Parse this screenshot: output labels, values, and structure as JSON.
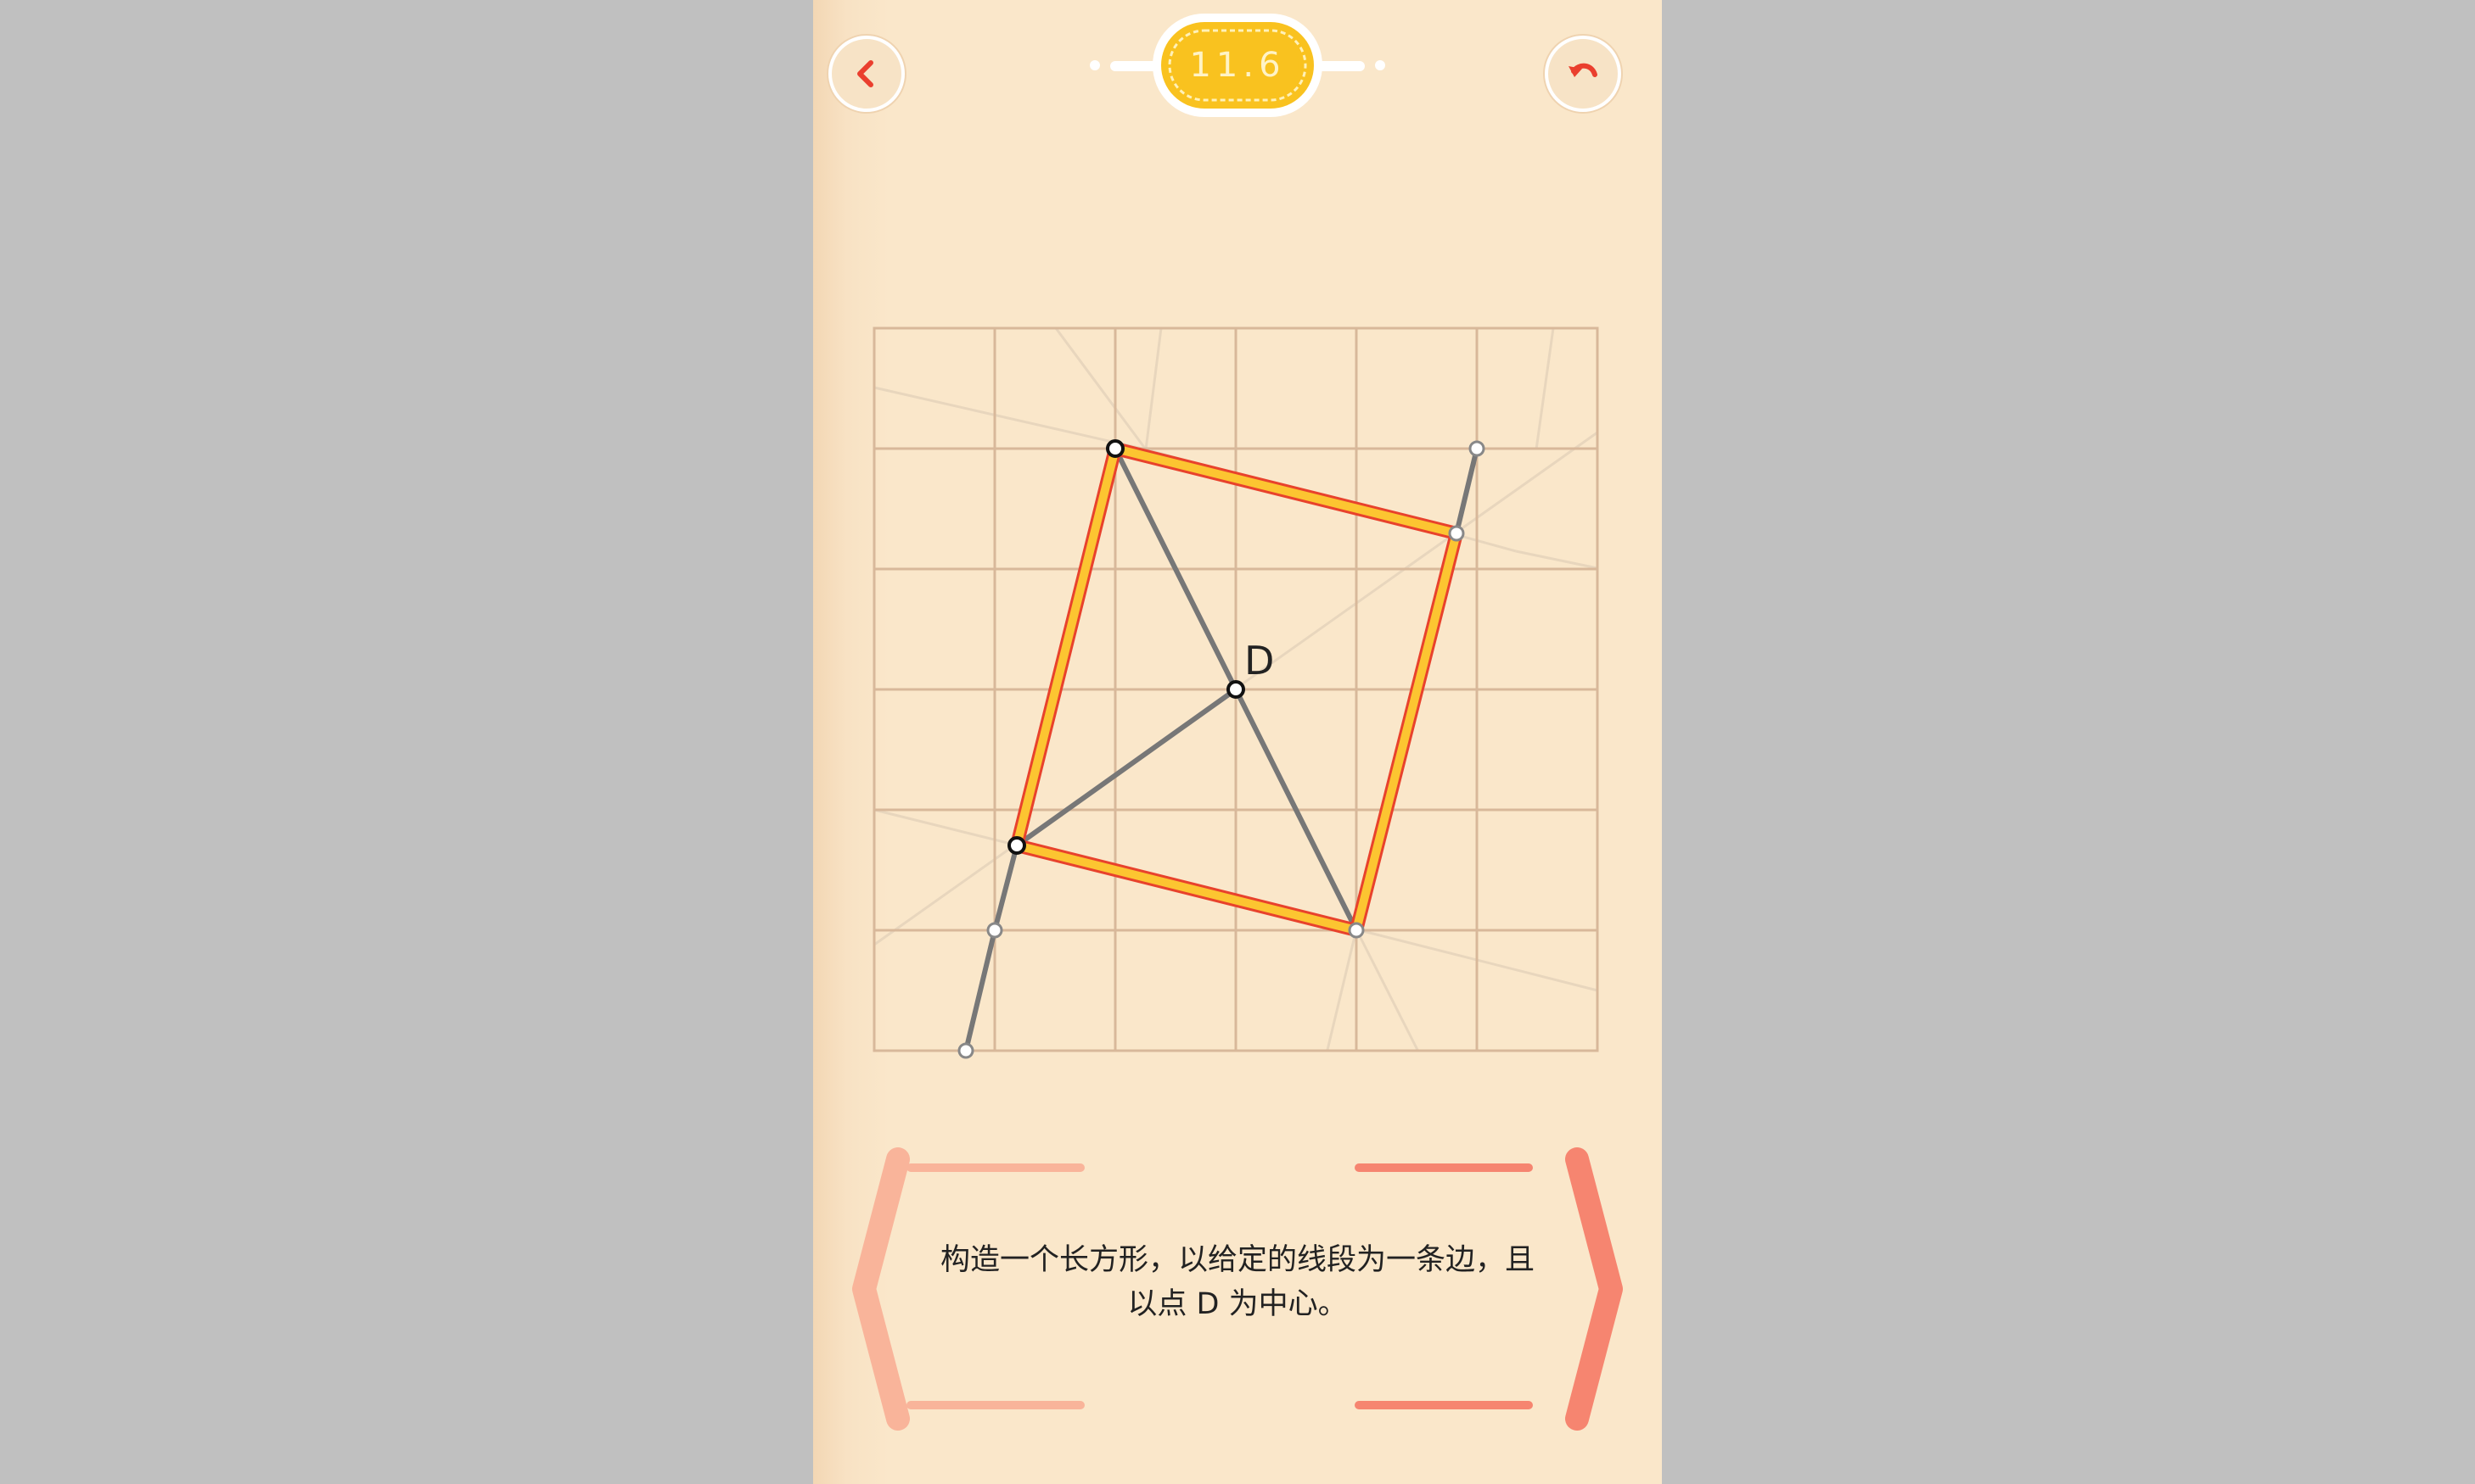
{
  "level": {
    "label": "11.6"
  },
  "puzzle": {
    "point_label": "D",
    "instruction_line1": "构造一个长方形，以给定的线段为一条边，且",
    "instruction_line2": "以点 D 为中心。"
  },
  "buttons": {
    "back_icon": "chevron-left-icon",
    "undo_icon": "undo-icon",
    "prev_icon": "chevron-left-large-icon",
    "next_icon": "chevron-right-large-icon"
  },
  "colors": {
    "accent_red": "#ea3f2e",
    "rectangle_fill": "#fcc531",
    "rectangle_edge": "#e8422c",
    "construction_line": "#777777",
    "grid_line": "#d8b89a",
    "faint_line": "#e8d6bd",
    "badge_gold": "#f9c21f",
    "arrow_prev": "#f9b49a",
    "arrow_next": "#f68570"
  }
}
